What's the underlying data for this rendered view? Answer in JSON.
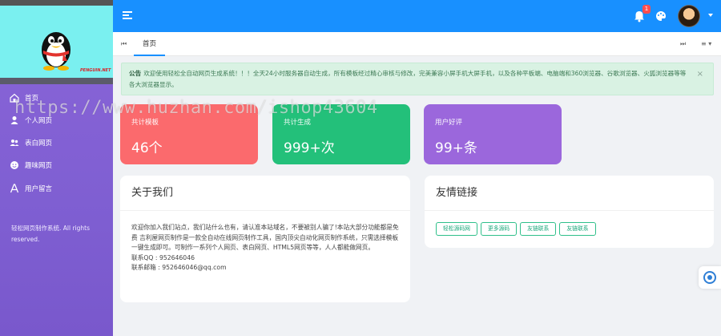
{
  "sidebar": {
    "logo_caption": "PENGUIN.NET",
    "items": [
      {
        "label": "首页",
        "icon": "home-icon"
      },
      {
        "label": "个人网页",
        "icon": "user-icon"
      },
      {
        "label": "表白网页",
        "icon": "users-icon"
      },
      {
        "label": "趣味网页",
        "icon": "smile-icon"
      },
      {
        "label": "用户留言",
        "icon": "font-icon"
      }
    ],
    "footer": "轻松网页制作系统. All rights reserved."
  },
  "header": {
    "notification_count": "1"
  },
  "tabs": {
    "home_label": "首页",
    "prev": "⏮",
    "next": "⏭",
    "menu": "≡ ▾"
  },
  "alert": {
    "title": "公告",
    "text": "欢迎使用轻松全自动网页生成系统！！！全天24小时服务器自动生成，所有模板经过精心审核与修改，完美兼容小屏手机大屏手机，以及各种平板端、电脑端和360浏览器、谷歌浏览器、火狐浏览器等等各大浏览器显示。"
  },
  "stats": [
    {
      "label": "共计模板",
      "value": "46个"
    },
    {
      "label": "共计生成",
      "value": "999+次"
    },
    {
      "label": "用户好评",
      "value": "99+条"
    }
  ],
  "about": {
    "title": "关于我们",
    "body": "欢迎你加入我们站点，我们站什么也有，请认准本站域名，不要被别人骗了!本站大部分功能都是免费 吉利屋网页制作是一款全自动在线网页制作工具，国内顶尖自动化网页制作系统，只需选择模板一键生成即可。可制作一系列个人网页、表白网页、HTML5网页等等，人人都能做网页。",
    "qq": "联系QQ : 952646046",
    "email": "联系邮箱 : 952646046@qq.com"
  },
  "links": {
    "title": "友情链接",
    "items": [
      "轻松源码网",
      "更多源码",
      "友链联系",
      "友链联系"
    ]
  },
  "watermark": "https://www.huzhan.com/ishop43604",
  "colors": {
    "header": "#1890ff",
    "sidebar": "#8a64d8",
    "stat_red": "#fb6a6d",
    "stat_green": "#23c07a",
    "stat_purple": "#9b67dc"
  }
}
